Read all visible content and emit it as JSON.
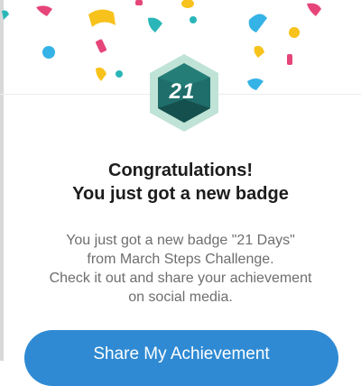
{
  "badge": {
    "number": "21",
    "colors": {
      "outer": "#bfe3d6",
      "face": "#1f6e6b",
      "dark": "#15504e"
    }
  },
  "confetti_colors": [
    "#f7c21b",
    "#e6457a",
    "#2ab6b8",
    "#35b3e6"
  ],
  "dialog": {
    "title_line1": "Congratulations!",
    "title_line2": "You just got a new badge",
    "message_lines": [
      "You just got a new badge \"21 Days\"",
      "from March Steps Challenge.",
      "Check it out and share your achievement",
      "on social media."
    ]
  },
  "share_button": {
    "label": "Share My Achievement",
    "color": "#2f8ad3"
  }
}
